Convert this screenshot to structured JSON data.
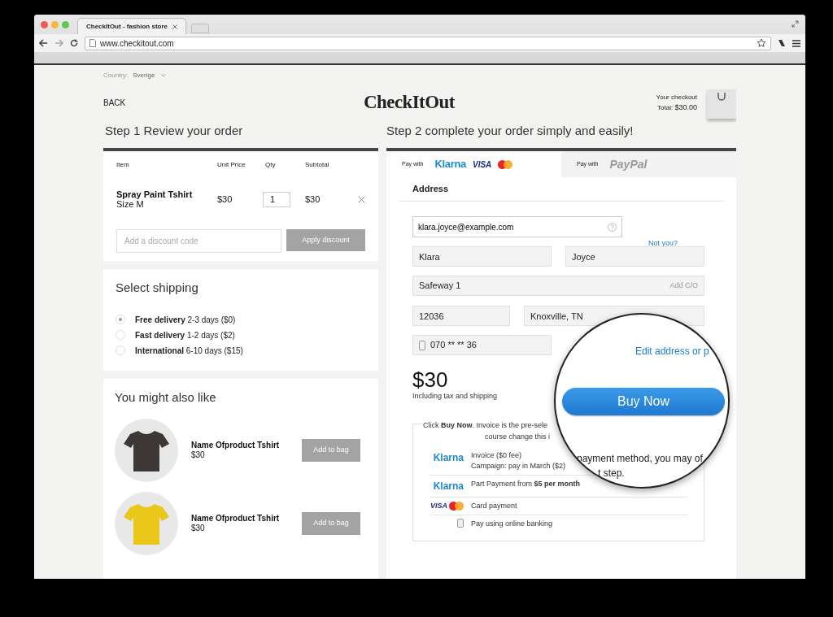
{
  "browser": {
    "tab_title": "CheckItOut - fashion store",
    "url": "www.checkitout.com"
  },
  "header": {
    "country_label": "Country:",
    "country_value": "Sverige",
    "back": "BACK",
    "logo": "CheckItOut",
    "checkout_label": "Your checkout",
    "total_label": "Total:",
    "total_value": "$30.00"
  },
  "step1": {
    "title": "Step 1 Review your order",
    "columns": [
      "Item",
      "Unit Price",
      "Qty",
      "Subtotal"
    ],
    "item": {
      "name": "Spray Paint Tshirt",
      "size": "Size M",
      "price": "$30",
      "qty": "1",
      "subtotal": "$30"
    },
    "discount": {
      "placeholder": "Add a discount code",
      "button": "Apply discount"
    }
  },
  "shipping": {
    "title": "Select shipping",
    "options": [
      {
        "name": "Free delivery",
        "detail": "2-3 days ($0)",
        "selected": true
      },
      {
        "name": "Fast delivery",
        "detail": "1-2 days ($2)",
        "selected": false
      },
      {
        "name": "International",
        "detail": "6-10 days ($15)",
        "selected": false
      }
    ]
  },
  "recommendations": {
    "title": "You might also like",
    "items": [
      {
        "name": "Name Ofproduct Tshirt",
        "price": "$30",
        "button": "Add to bag",
        "color": "#3d3836"
      },
      {
        "name": "Name Ofproduct Tshirt",
        "price": "$30",
        "button": "Add to bag",
        "color": "#e8c71a"
      }
    ]
  },
  "step2": {
    "title": "Step 2 complete your order simply and easily!",
    "tabs": [
      {
        "label": "Pay with",
        "selected": true,
        "logos": [
          {
            "kind": "klarna",
            "text": "Klarna"
          },
          {
            "kind": "visa",
            "text": "VISA"
          },
          {
            "kind": "mastercard"
          }
        ]
      },
      {
        "label": "Pay with",
        "selected": false,
        "logos": [
          {
            "kind": "paypal",
            "text": "PayPal"
          }
        ]
      }
    ],
    "address": {
      "title": "Address",
      "email": "klara.joyce@example.com",
      "not_you": "Not you?",
      "first_name": "Klara",
      "last_name": "Joyce",
      "street": "Safeway 1",
      "add_co": "Add C/O",
      "zip": "12036",
      "city": "Knoxville, TN",
      "phone": "070 ** ** 36"
    },
    "total": {
      "amount": "$30",
      "note": "Including tax and shipping"
    },
    "info": {
      "line1": "Click **Buy Now**. Invoice is the pre-sele",
      "line2": "course change this i"
    },
    "methods": [
      {
        "kind": "klarna",
        "logo": "Klarna",
        "lines": [
          "Invoice ($0 fee)",
          "Campaign: pay in March ($2)"
        ]
      },
      {
        "kind": "klarna",
        "logo": "Klarna",
        "lines": [
          "Part Payment from **$5 per month**"
        ]
      },
      {
        "kind": "cards",
        "logo": "VISA",
        "lines": [
          "Card payment"
        ]
      },
      {
        "kind": "bank",
        "lines": [
          "Pay using online banking"
        ]
      }
    ]
  },
  "magnifier": {
    "link": "Edit address or p",
    "button": "Buy Now",
    "text1": "payment method, you may of",
    "text2": "t step."
  }
}
